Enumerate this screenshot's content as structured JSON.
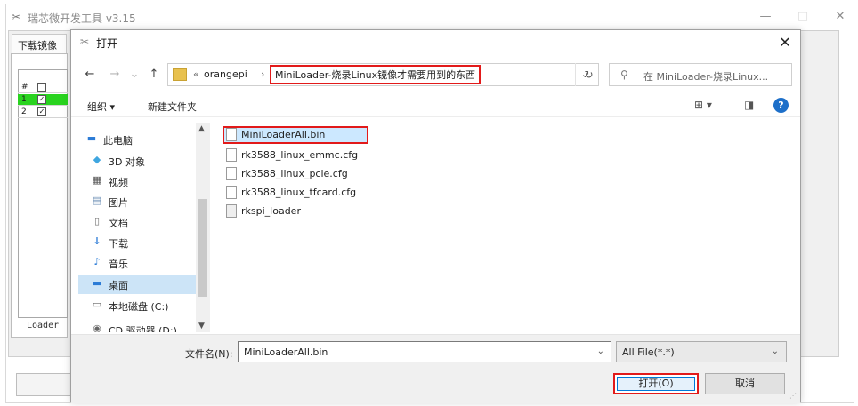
{
  "background_app": {
    "title": "瑞芯微开发工具 v3.15",
    "tab_label": "下载镜像",
    "grid_header": [
      "#",
      "□"
    ],
    "rows": [
      {
        "num": "1",
        "checked": "✓"
      },
      {
        "num": "2",
        "checked": "✓"
      }
    ],
    "loader_label": "Loader",
    "window_controls": {
      "minimize": "—",
      "maximize": "□",
      "close": "✕"
    },
    "colors": {
      "selected_row": "#29d31f"
    }
  },
  "dialog": {
    "title": "打开",
    "close": "✕",
    "nav": {
      "back": "←",
      "forward": "→",
      "recent": "⌄",
      "up": "↑"
    },
    "address": {
      "prefix": "«",
      "crumbs": [
        "orangepi",
        "MiniLoader-烧录Linux镜像才需要用到的东西"
      ],
      "separator": "›",
      "dropdown": "⌄"
    },
    "refresh": "↻",
    "search": {
      "icon": "⚲",
      "placeholder": "在 MiniLoader-烧录Linux..."
    },
    "toolbar": {
      "organize": "组织 ▾",
      "new_folder": "新建文件夹",
      "view_icon": "⊞ ▾",
      "pane_icon": "◨",
      "help": "?"
    },
    "nav_pane": [
      {
        "label": "此电脑",
        "icon": "computer-icon",
        "glyph": "▬"
      },
      {
        "label": "3D 对象",
        "icon": "cube-icon",
        "glyph": "◆"
      },
      {
        "label": "视频",
        "icon": "video-icon",
        "glyph": "▦"
      },
      {
        "label": "图片",
        "icon": "picture-icon",
        "glyph": "▤"
      },
      {
        "label": "文档",
        "icon": "document-icon",
        "glyph": "▯"
      },
      {
        "label": "下载",
        "icon": "download-icon",
        "glyph": "↓"
      },
      {
        "label": "音乐",
        "icon": "music-icon",
        "glyph": "♪"
      },
      {
        "label": "桌面",
        "icon": "desktop-icon",
        "glyph": "▬",
        "selected": true
      },
      {
        "label": "本地磁盘 (C:)",
        "icon": "disk-icon",
        "glyph": "▭"
      },
      {
        "label": "CD 驱动器 (D:)",
        "icon": "cd-icon",
        "glyph": "◉"
      }
    ],
    "files": [
      {
        "name": "MiniLoaderAll.bin",
        "selected": true
      },
      {
        "name": "rk3588_linux_emmc.cfg"
      },
      {
        "name": "rk3588_linux_pcie.cfg"
      },
      {
        "name": "rk3588_linux_tfcard.cfg"
      },
      {
        "name": "rkspi_loader"
      }
    ],
    "filename_label": "文件名(N):",
    "filename_value": "MiniLoaderAll.bin",
    "filetype_value": "All File(*.*)",
    "open_button": "打开(O)",
    "cancel_button": "取消",
    "colors": {
      "highlight": "#e21a1a",
      "selection": "#cce8ff",
      "accent": "#0078d7"
    }
  }
}
